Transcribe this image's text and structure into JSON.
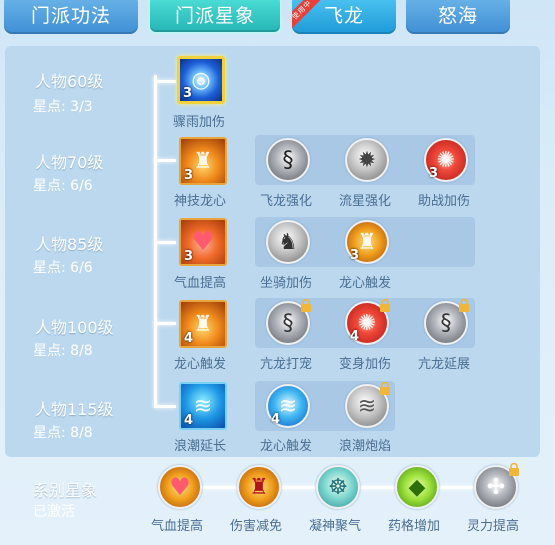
{
  "tabs": [
    {
      "label": "门派功法"
    },
    {
      "label": "门派星象"
    },
    {
      "label": "飞龙",
      "ribbon": "使用中"
    },
    {
      "label": "怒海"
    }
  ],
  "rows": [
    {
      "level": "人物60级",
      "stars": "星点: 3/3",
      "main": {
        "name": "骤雨加伤",
        "count": "3",
        "icon": "water-swirl-icon"
      },
      "subs": []
    },
    {
      "level": "人物70级",
      "stars": "星点: 6/6",
      "main": {
        "name": "神技龙心",
        "count": "3",
        "icon": "fire-warrior-icon"
      },
      "subs": [
        {
          "name": "飞龙强化",
          "count": "",
          "icon": "dragon-icon",
          "locked": false
        },
        {
          "name": "流星强化",
          "count": "",
          "icon": "meteor-icon",
          "locked": false
        },
        {
          "name": "助战加伤",
          "count": "3",
          "icon": "aura-icon",
          "locked": false
        }
      ]
    },
    {
      "level": "人物85级",
      "stars": "星点: 6/6",
      "main": {
        "name": "气血提高",
        "count": "3",
        "icon": "heart-icon"
      },
      "subs": [
        {
          "name": "坐骑加伤",
          "count": "",
          "icon": "mount-icon",
          "locked": false
        },
        {
          "name": "龙心触发",
          "count": "3",
          "icon": "fire-warrior-icon",
          "locked": false
        }
      ]
    },
    {
      "level": "人物100级",
      "stars": "星点: 8/8",
      "main": {
        "name": "龙心触发",
        "count": "4",
        "icon": "fire-warrior-icon"
      },
      "subs": [
        {
          "name": "亢龙打宠",
          "count": "",
          "icon": "dragon-claw-icon",
          "locked": true
        },
        {
          "name": "变身加伤",
          "count": "4",
          "icon": "aura-icon",
          "locked": true
        },
        {
          "name": "亢龙延展",
          "count": "",
          "icon": "dragon-claw-icon",
          "locked": true
        }
      ]
    },
    {
      "level": "人物115级",
      "stars": "星点: 8/8",
      "main": {
        "name": "浪潮延长",
        "count": "4",
        "icon": "wave-icon"
      },
      "subs": [
        {
          "name": "龙心触发",
          "count": "4",
          "icon": "wave-icon",
          "locked": false
        },
        {
          "name": "浪潮炮焰",
          "count": "",
          "icon": "wave-icon",
          "locked": true
        }
      ]
    }
  ],
  "system": {
    "title": "系别星象",
    "state": "已激活",
    "items": [
      {
        "name": "气血提高",
        "icon": "heart-icon",
        "locked": false
      },
      {
        "name": "伤害减免",
        "icon": "armor-icon",
        "locked": false
      },
      {
        "name": "凝神聚气",
        "icon": "meditation-icon",
        "locked": false
      },
      {
        "name": "药格增加",
        "icon": "gem-icon",
        "locked": false
      },
      {
        "name": "灵力提高",
        "icon": "spirit-icon",
        "locked": true
      }
    ]
  }
}
